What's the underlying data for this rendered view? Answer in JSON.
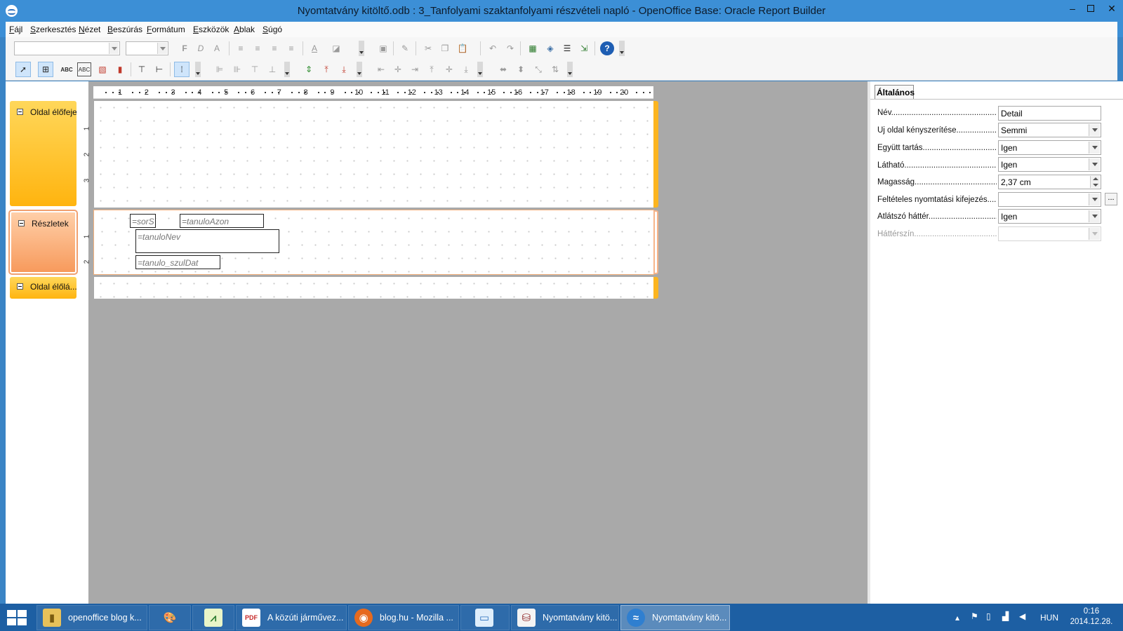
{
  "window": {
    "title": "Nyomtatvány kitöltő.odb : 3_Tanfolyami szaktanfolyami részvételi napló - OpenOffice Base: Oracle Report Builder"
  },
  "menu": [
    "Fájl",
    "Szerkesztés",
    "Nézet",
    "Beszúrás",
    "Formátum",
    "Eszközök",
    "Ablak",
    "Súgó"
  ],
  "toolbar1": {
    "font_name": "",
    "font_size": "",
    "bold_glyph": "F",
    "italic_glyph": "D",
    "shadow_glyph": "A"
  },
  "toolbar2": {
    "label_field_glyph": "ABC",
    "text_field_glyph": "ABC"
  },
  "ruler": {
    "h_ticks": [
      "1",
      "2",
      "3",
      "4",
      "5",
      "6",
      "7",
      "8",
      "9",
      "10",
      "11",
      "12",
      "13",
      "14",
      "15",
      "16",
      "17",
      "18",
      "19",
      "20"
    ],
    "v_header": [
      "1",
      "2",
      "3"
    ],
    "v_detail": [
      "1",
      "2"
    ]
  },
  "sections": {
    "page_header": "Oldal élőfeje",
    "detail": "Részletek",
    "page_footer": "Oldal élőlá..."
  },
  "fields": {
    "sorszam": "=sorS",
    "tanulo_azon": "=tanuloAzon",
    "tanulo_nev": "=tanuloNev",
    "tanulo_szuldat": "=tanulo_szulDat"
  },
  "properties": {
    "tab_general": "Általános",
    "rows": [
      {
        "label": "Név.........................................................",
        "value": "Detail"
      },
      {
        "label": "Új oldal kényszerítése...................................",
        "value": "Semmi"
      },
      {
        "label": "Együtt tartás...............................................",
        "value": "Igen"
      },
      {
        "label": "Látható.........................................................",
        "value": "Igen"
      },
      {
        "label": "Magasság......................................................",
        "value": "2,37 cm"
      },
      {
        "label": "Feltételes nyomtatási kifejezés.....",
        "value": "",
        "button": "..."
      },
      {
        "label": "Átlátszó háttér...............................................",
        "value": "Igen"
      },
      {
        "label": "Háttérszín......................................................",
        "value": ""
      }
    ]
  },
  "taskbar": {
    "items": [
      {
        "label": "openoffice blog k...",
        "icon": "folder-icon"
      },
      {
        "label": "",
        "icon": "paint-icon"
      },
      {
        "label": "",
        "icon": "chart-app-icon"
      },
      {
        "label": "A közúti járművez...",
        "icon": "pdf-icon"
      },
      {
        "label": "blog.hu - Mozilla ...",
        "icon": "firefox-icon"
      },
      {
        "label": "",
        "icon": "notepad-icon"
      },
      {
        "label": "Nyomtatvány kitö...",
        "icon": "base-icon"
      },
      {
        "label": "Nyomtatvány kitö...",
        "icon": "openoffice-icon"
      }
    ],
    "language": "HUN",
    "time": "0:16",
    "date": "2014.12.28."
  },
  "colors": {
    "titlebar": "#3c8fd6",
    "taskbar": "#1d5fa3",
    "section_header": "#ffb40f",
    "section_detail": "#f79a5c"
  }
}
